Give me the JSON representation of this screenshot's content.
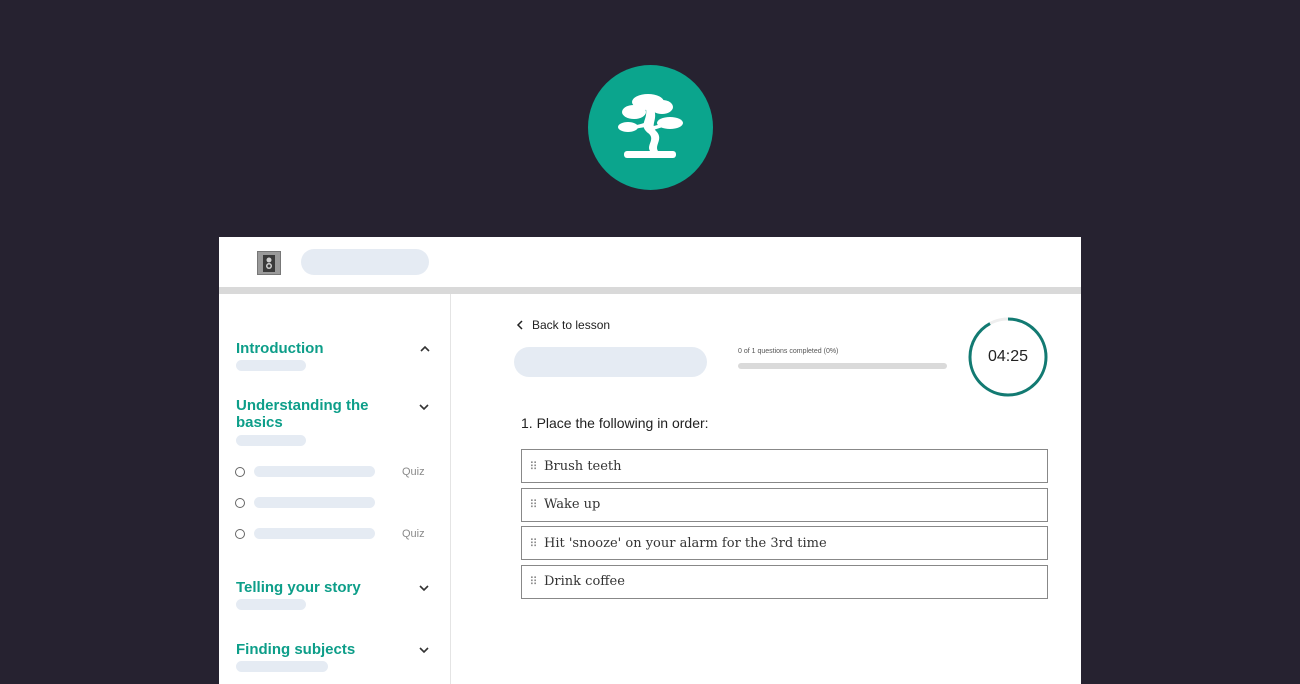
{
  "brand": {
    "logo_icon": "bonsai-tree-icon",
    "color": "#0ba58d"
  },
  "sidebar": {
    "sections": [
      {
        "title": "Introduction",
        "expanded": true
      },
      {
        "title": "Understanding the basics",
        "expanded": false,
        "lessons": [
          {
            "tag": "Quiz"
          },
          {
            "tag": ""
          },
          {
            "tag": "Quiz"
          }
        ]
      },
      {
        "title": "Telling your story",
        "expanded": false
      },
      {
        "title": "Finding subjects",
        "expanded": false
      }
    ]
  },
  "main": {
    "back_label": "Back to lesson",
    "progress": {
      "text": "0 of 1 questions completed (0%)",
      "fraction": 0.0
    },
    "timer": {
      "value": "04:25",
      "fraction_remaining": 0.92
    },
    "question": {
      "text": "1. Place the following in order:",
      "items": [
        "Brush teeth",
        "Wake up",
        "Hit 'snooze' on your alarm for the 3rd time",
        "Drink coffee"
      ]
    }
  },
  "colors": {
    "accent": "#0d9e89",
    "background": "#262230"
  }
}
